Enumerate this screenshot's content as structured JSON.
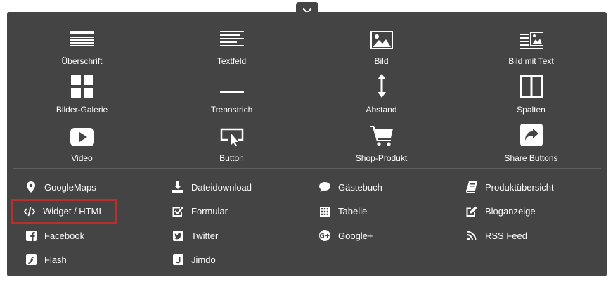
{
  "close": {
    "label": "×",
    "icon": "close-icon"
  },
  "tiles": [
    [
      {
        "label": "Überschrift",
        "icon": "heading-icon"
      },
      {
        "label": "Textfeld",
        "icon": "text-icon"
      },
      {
        "label": "Bild",
        "icon": "image-icon"
      },
      {
        "label": "Bild mit Text",
        "icon": "image-with-text-icon"
      }
    ],
    [
      {
        "label": "Bilder-Galerie",
        "icon": "gallery-icon"
      },
      {
        "label": "Trennstrich",
        "icon": "divider-icon"
      },
      {
        "label": "Abstand",
        "icon": "spacer-icon"
      },
      {
        "label": "Spalten",
        "icon": "columns-icon"
      }
    ],
    [
      {
        "label": "Video",
        "icon": "video-icon"
      },
      {
        "label": "Button",
        "icon": "button-icon"
      },
      {
        "label": "Shop-Produkt",
        "icon": "cart-icon"
      },
      {
        "label": "Share Buttons",
        "icon": "share-icon"
      }
    ]
  ],
  "list": [
    [
      {
        "label": "GoogleMaps",
        "icon": "map-pin-icon"
      },
      {
        "label": "Dateidownload",
        "icon": "download-icon"
      },
      {
        "label": "Gästebuch",
        "icon": "speech-bubble-icon"
      },
      {
        "label": "Produktübersicht",
        "icon": "book-icon"
      }
    ],
    [
      {
        "label": "Widget / HTML",
        "icon": "code-icon",
        "highlighted": true
      },
      {
        "label": "Formular",
        "icon": "checkbox-icon"
      },
      {
        "label": "Tabelle",
        "icon": "table-icon"
      },
      {
        "label": "Bloganzeige",
        "icon": "edit-icon"
      }
    ],
    [
      {
        "label": "Facebook",
        "icon": "facebook-icon"
      },
      {
        "label": "Twitter",
        "icon": "twitter-icon"
      },
      {
        "label": "Google+",
        "icon": "google-plus-icon"
      },
      {
        "label": "RSS Feed",
        "icon": "rss-icon"
      }
    ],
    [
      {
        "label": "Flash",
        "icon": "flash-icon"
      },
      {
        "label": "Jimdo",
        "icon": "jimdo-icon"
      }
    ]
  ],
  "colors": {
    "panel": "#444444",
    "highlight": "#b6312b",
    "text": "#ffffff"
  }
}
